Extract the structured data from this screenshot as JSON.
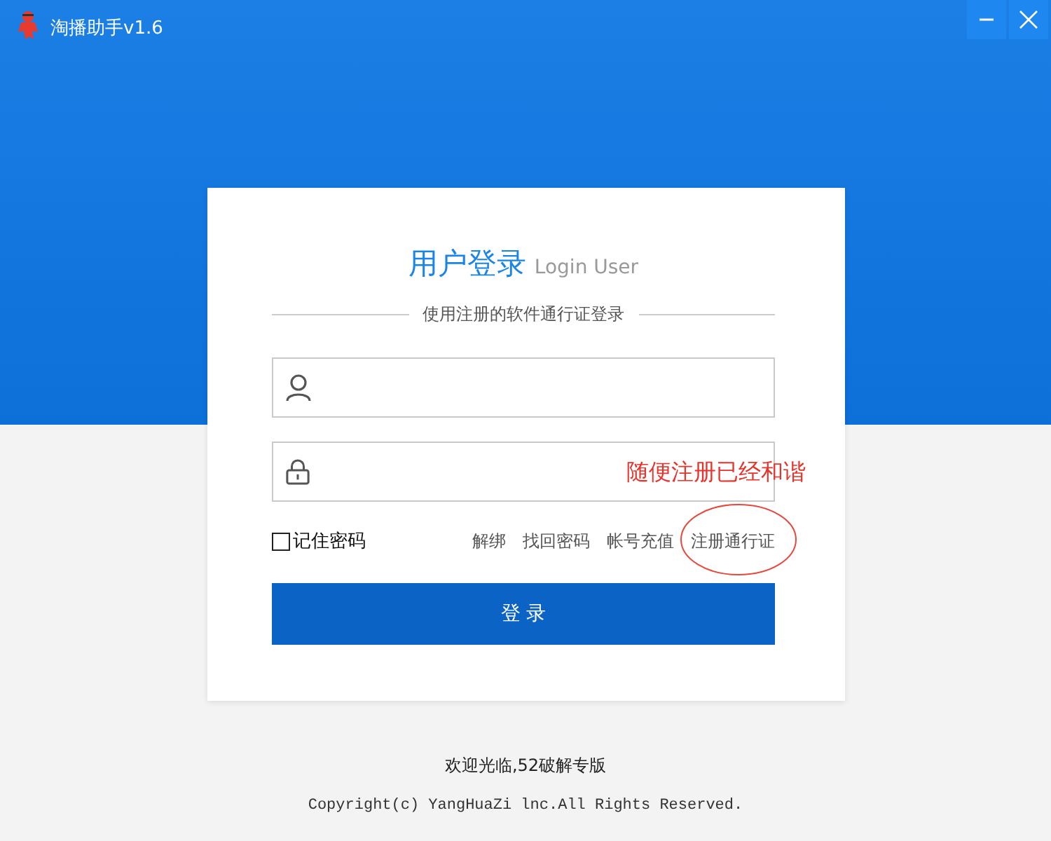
{
  "window": {
    "title": "淘播助手v1.6"
  },
  "login": {
    "title": "用户登录",
    "subtitle": "Login User",
    "hint": "使用注册的软件通行证登录",
    "remember": {
      "label": "记住密码",
      "checked": false
    },
    "links": [
      {
        "label": "解绑",
        "circled": false
      },
      {
        "label": "找回密码",
        "circled": false
      },
      {
        "label": "帐号充值",
        "circled": false
      },
      {
        "label": "注册通行证",
        "circled": true
      }
    ],
    "annotation": "随便注册已经和谐",
    "button": "登 录"
  },
  "footer": {
    "welcome": "欢迎光临,52破解专版",
    "copyright": "Copyright(c) YangHuaZi lnc.All Rights Reserved."
  }
}
